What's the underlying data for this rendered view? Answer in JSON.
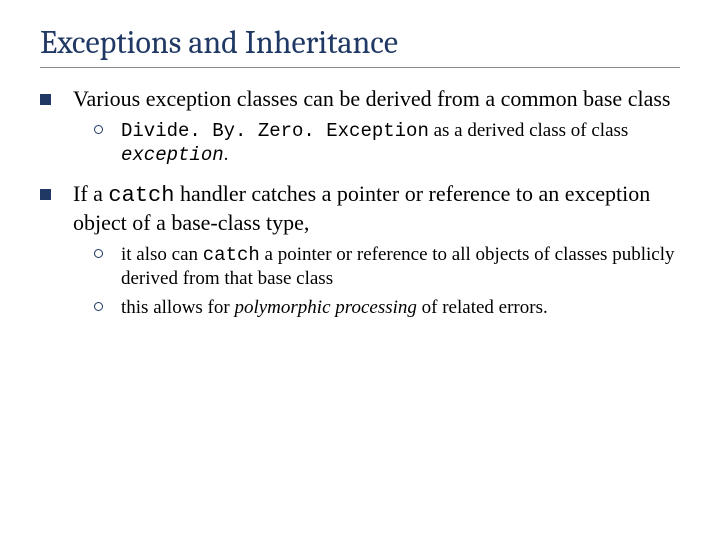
{
  "title": "Exceptions and Inheritance",
  "b1": {
    "text": "Various exception classes can be derived from a common base class",
    "sub1": {
      "code": "Divide. By. Zero. Exception",
      "mid": " as a derived class of class ",
      "code2": "exception",
      "end": "."
    }
  },
  "b2": {
    "pre": "If a ",
    "code": "catch",
    "post": " handler catches a pointer or reference to an exception object of a base-class type,",
    "sub1": {
      "pre": "it also can ",
      "code": "catch",
      "post": " a pointer or reference to all objects of classes publicly derived from that base class"
    },
    "sub2": {
      "pre": "this allows for ",
      "em": "polymorphic processing",
      "post": " of related errors."
    }
  }
}
